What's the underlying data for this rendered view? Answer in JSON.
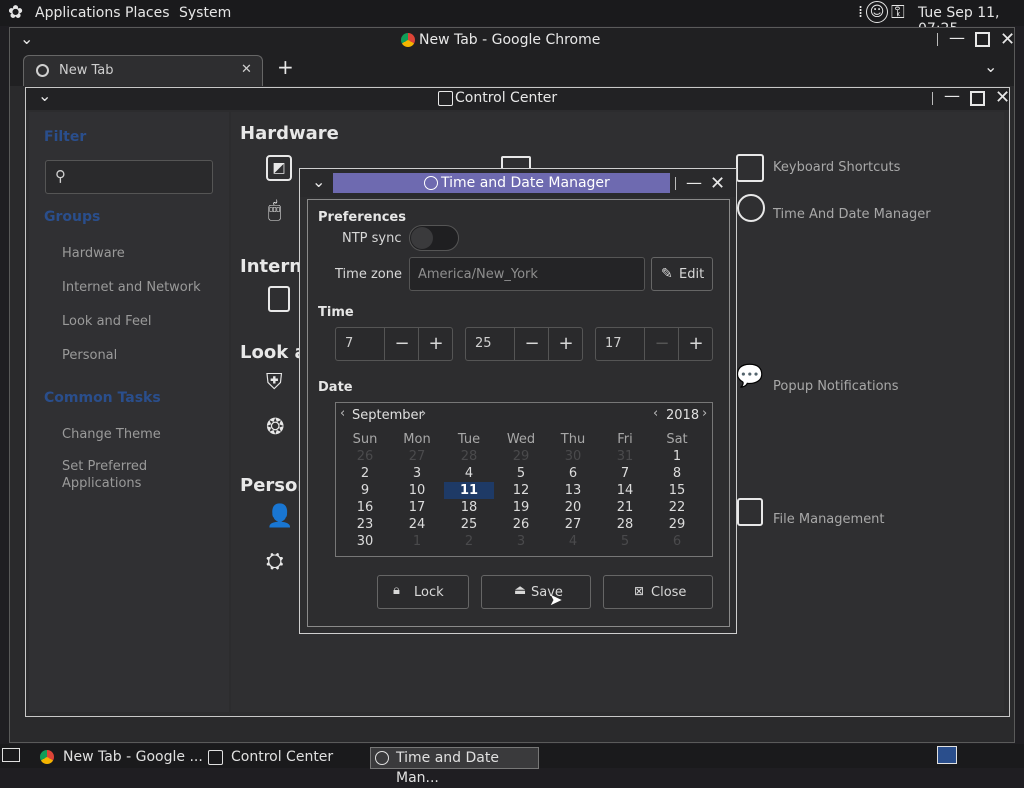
{
  "top_panel": {
    "menus": [
      "Applications",
      "Places",
      "System"
    ],
    "clock": "Tue Sep 11, 07:25"
  },
  "chrome": {
    "title": "New Tab - Google Chrome",
    "tab_label": "New Tab",
    "new_tab": "+"
  },
  "control_center": {
    "title": "Control Center",
    "sidebar": {
      "filter_heading": "Filter",
      "groups_heading": "Groups",
      "groups": [
        "Hardware",
        "Internet and Network",
        "Look and Feel",
        "Personal"
      ],
      "common_tasks_heading": "Common Tasks",
      "tasks": [
        "Change Theme",
        "Set Preferred Applications"
      ]
    },
    "categories": [
      "Hardware",
      "Interne",
      "Look ar",
      "Person"
    ],
    "applets": [
      "Keyboard Shortcuts",
      "Time And Date Manager",
      "Popup Notifications",
      "File Management"
    ]
  },
  "dialog": {
    "title": "Time and Date Manager",
    "preferences_label": "Preferences",
    "ntp_label": "NTP sync",
    "ntp_on": false,
    "timezone_label": "Time zone",
    "timezone_value": "America/New_York",
    "edit_label": "Edit",
    "time_label": "Time",
    "hour": "7",
    "minute": "25",
    "second": "17",
    "date_label": "Date",
    "month": "September",
    "year": "2018",
    "weekdays": [
      "Sun",
      "Mon",
      "Tue",
      "Wed",
      "Thu",
      "Fri",
      "Sat"
    ],
    "weeks": [
      [
        "26",
        "27",
        "28",
        "29",
        "30",
        "31",
        "1"
      ],
      [
        "2",
        "3",
        "4",
        "5",
        "6",
        "7",
        "8"
      ],
      [
        "9",
        "10",
        "11",
        "12",
        "13",
        "14",
        "15"
      ],
      [
        "16",
        "17",
        "18",
        "19",
        "20",
        "21",
        "22"
      ],
      [
        "23",
        "24",
        "25",
        "26",
        "27",
        "28",
        "29"
      ],
      [
        "30",
        "1",
        "2",
        "3",
        "4",
        "5",
        "6"
      ]
    ],
    "selected_day": "11",
    "lock_label": "Lock",
    "save_label": "Save",
    "close_label": "Close"
  },
  "taskbar": {
    "tasks": [
      "New Tab - Google ...",
      "Control Center",
      "Time and Date Man..."
    ]
  },
  "colors": {
    "dialog_title_bg": "#6e6ab0",
    "selected_day_bg": "#1e3a66",
    "link_blue": "#2a4e8c"
  }
}
